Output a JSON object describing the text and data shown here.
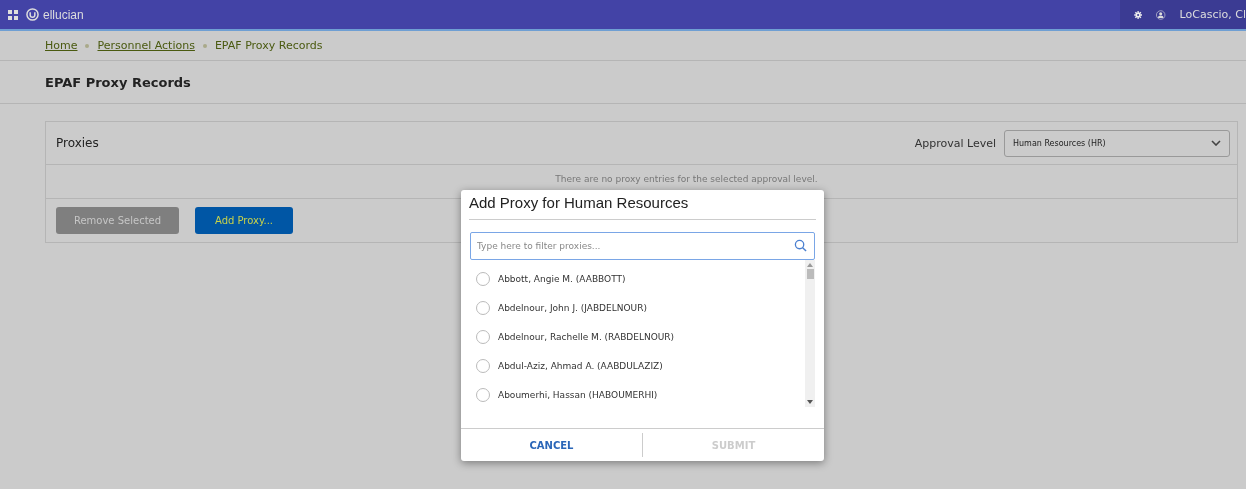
{
  "header": {
    "brand": "ellucian",
    "user": "LoCascio, Cl"
  },
  "breadcrumb": [
    {
      "label": "Home",
      "link": true
    },
    {
      "label": "Personnel Actions",
      "link": true
    },
    {
      "label": "EPAF Proxy Records",
      "link": false
    }
  ],
  "page_title": "EPAF Proxy Records",
  "panel": {
    "title": "Proxies",
    "approval_label": "Approval Level",
    "approval_value": "Human Resources (HR)",
    "empty_message": "There are no proxy entries for the selected approval level.",
    "buttons": [
      {
        "label": "Remove Selected",
        "disabled": true
      },
      {
        "label": "Add Proxy...",
        "disabled": false
      }
    ]
  },
  "dialog": {
    "title": "Add Proxy for Human Resources",
    "search": {
      "placeholder": "Type here to filter proxies..."
    },
    "items": [
      {
        "label": "Abbott, Angie M. (AABBOTT)",
        "selected": false
      },
      {
        "label": "Abdelnour, John J. (JABDELNOUR)",
        "selected": false
      },
      {
        "label": "Abdelnour, Rachelle M. (RABDELNOUR)",
        "selected": false
      },
      {
        "label": "Abdul-Aziz, Ahmad A. (AABDULAZIZ)",
        "selected": false
      },
      {
        "label": "Aboumerhi, Hassan (HABOUMERHI)",
        "selected": false
      }
    ],
    "buttons": [
      {
        "label": "CANCEL",
        "disabled": false
      },
      {
        "label": "SUBMIT",
        "disabled": true
      }
    ]
  }
}
